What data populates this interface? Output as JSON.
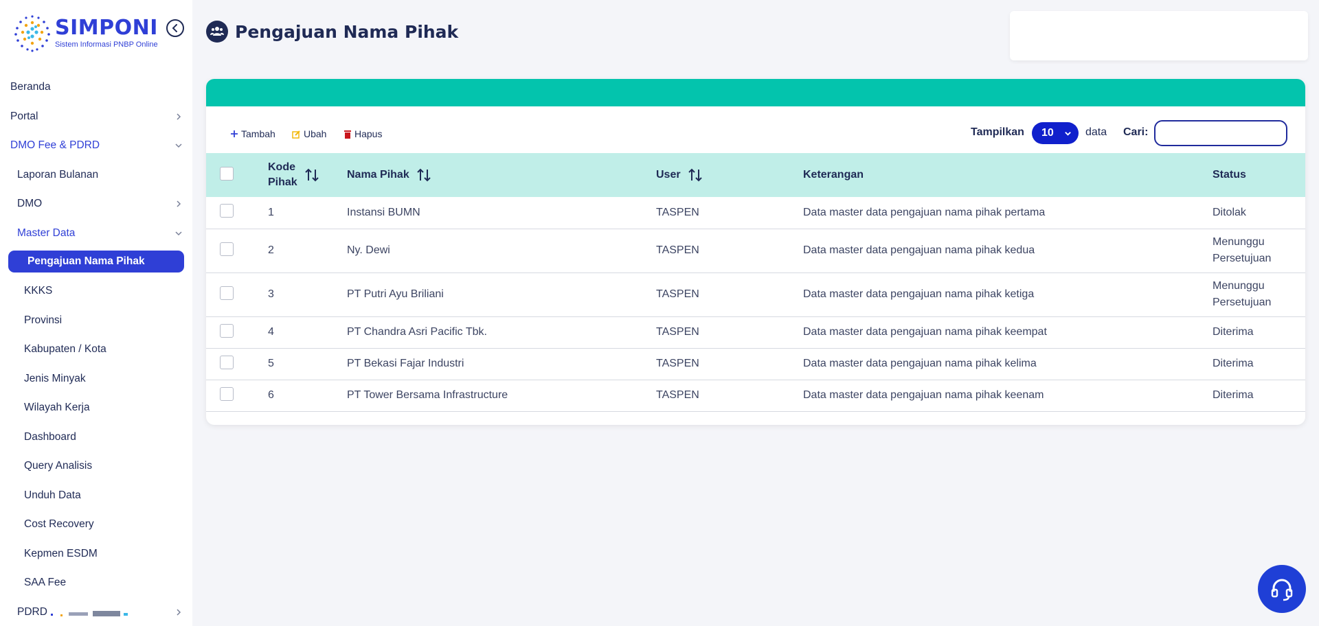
{
  "logo": {
    "title": "SIMPONI",
    "subtitle": "Sistem Informasi PNBP Online"
  },
  "sidebar": {
    "items": [
      {
        "label": "Beranda"
      },
      {
        "label": "Portal"
      },
      {
        "label": "DMO Fee & PDRD"
      },
      {
        "label": "Laporan Bulanan"
      },
      {
        "label": "DMO"
      },
      {
        "label": "Master Data"
      },
      {
        "label": "Pengajuan Nama Pihak"
      },
      {
        "label": "KKKS"
      },
      {
        "label": "Provinsi"
      },
      {
        "label": "Kabupaten / Kota"
      },
      {
        "label": "Jenis Minyak"
      },
      {
        "label": "Wilayah Kerja"
      },
      {
        "label": "Dashboard"
      },
      {
        "label": "Query Analisis"
      },
      {
        "label": "Unduh Data"
      },
      {
        "label": "Cost Recovery"
      },
      {
        "label": "Kepmen ESDM"
      },
      {
        "label": "SAA Fee"
      },
      {
        "label": "PDRD"
      }
    ]
  },
  "header": {
    "title": "Pengajuan Nama Pihak"
  },
  "toolbar": {
    "add_label": "Tambah",
    "edit_label": "Ubah",
    "delete_label": "Hapus",
    "show_label": "Tampilkan",
    "page_size": "10",
    "data_label": "data",
    "search_label": "Cari:",
    "search_value": ""
  },
  "table": {
    "columns": {
      "kode_line1": "Kode",
      "kode_line2": "Pihak",
      "nama": "Nama Pihak",
      "user": "User",
      "keterangan": "Keterangan",
      "status": "Status"
    },
    "rows": [
      {
        "kode": "1",
        "nama": "Instansi BUMN",
        "user": "TASPEN",
        "keterangan": "Data master data pengajuan nama pihak pertama",
        "status1": "Ditolak",
        "status2": ""
      },
      {
        "kode": "2",
        "nama": "Ny. Dewi",
        "user": "TASPEN",
        "keterangan": "Data master data pengajuan nama pihak kedua",
        "status1": "Menunggu",
        "status2": "Persetujuan"
      },
      {
        "kode": "3",
        "nama": "PT Putri Ayu Briliani",
        "user": "TASPEN",
        "keterangan": "Data master data pengajuan nama pihak ketiga",
        "status1": "Menunggu",
        "status2": "Persetujuan"
      },
      {
        "kode": "4",
        "nama": "PT Chandra Asri Pacific Tbk.",
        "user": "TASPEN",
        "keterangan": "Data master data pengajuan nama pihak keempat",
        "status1": "Diterima",
        "status2": ""
      },
      {
        "kode": "5",
        "nama": "PT Bekasi Fajar Industri",
        "user": "TASPEN",
        "keterangan": "Data master data pengajuan nama pihak kelima",
        "status1": "Diterima",
        "status2": ""
      },
      {
        "kode": "6",
        "nama": "PT Tower Bersama Infrastructure",
        "user": "TASPEN",
        "keterangan": "Data master data pengajuan nama pihak keenam",
        "status1": "Diterima",
        "status2": ""
      }
    ]
  },
  "colors": {
    "brand": "#2f3fd6",
    "band": "#03c4ad",
    "header_row": "#c0eee8",
    "navy": "#1f2a55"
  }
}
